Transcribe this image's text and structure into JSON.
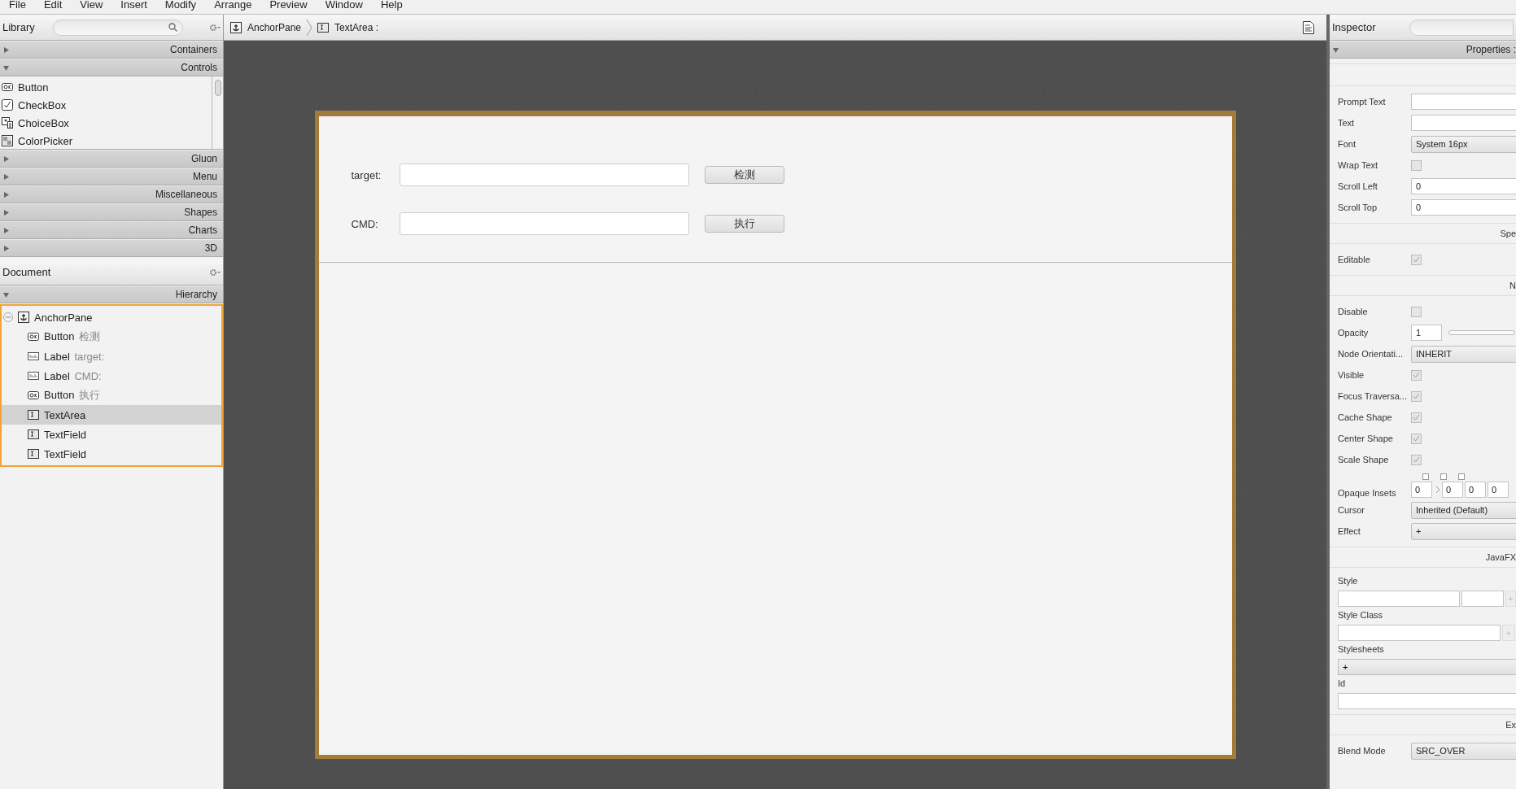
{
  "menu_bar": [
    "File",
    "Edit",
    "View",
    "Insert",
    "Modify",
    "Arrange",
    "Preview",
    "Window",
    "Help"
  ],
  "library": {
    "title": "Library",
    "sections": [
      {
        "label": "Containers",
        "expanded": false
      },
      {
        "label": "Controls",
        "expanded": true,
        "items": [
          {
            "label": "Button",
            "kind": "button"
          },
          {
            "label": "CheckBox",
            "kind": "checkbox"
          },
          {
            "label": "ChoiceBox",
            "kind": "choicebox"
          },
          {
            "label": "ColorPicker",
            "kind": "colorpicker"
          }
        ]
      },
      {
        "label": "Gluon",
        "expanded": false
      },
      {
        "label": "Menu",
        "expanded": false
      },
      {
        "label": "Miscellaneous",
        "expanded": false
      },
      {
        "label": "Shapes",
        "expanded": false
      },
      {
        "label": "Charts",
        "expanded": false
      },
      {
        "label": "3D",
        "expanded": false
      }
    ]
  },
  "document": {
    "title": "Document",
    "section": "Hierarchy",
    "tree": [
      {
        "label": "AnchorPane",
        "kind": "anchorpane",
        "expanded": true,
        "selected": false,
        "children": [
          {
            "label": "Button",
            "detail": "检测",
            "kind": "button",
            "selected": false
          },
          {
            "label": "Label",
            "detail": "target:",
            "kind": "label",
            "selected": false
          },
          {
            "label": "Label",
            "detail": "CMD:",
            "kind": "label",
            "selected": false
          },
          {
            "label": "Button",
            "detail": "执行",
            "kind": "button",
            "selected": false
          },
          {
            "label": "TextArea",
            "kind": "textarea",
            "selected": true
          },
          {
            "label": "TextField",
            "kind": "textfield",
            "selected": false
          },
          {
            "label": "TextField",
            "kind": "textfield",
            "selected": false
          }
        ]
      }
    ]
  },
  "breadcrumb": [
    {
      "label": "AnchorPane",
      "kind": "anchorpane"
    },
    {
      "label": "TextArea :",
      "kind": "textarea"
    }
  ],
  "canvas": {
    "rows": [
      {
        "label": "target:",
        "button": "检测"
      },
      {
        "label": "CMD:",
        "button": "执行"
      }
    ]
  },
  "inspector": {
    "title": "Inspector",
    "section": "Properties :",
    "rows": [
      {
        "kind": "section"
      },
      {
        "kind": "field",
        "label": "Prompt Text"
      },
      {
        "kind": "field",
        "label": "Text"
      },
      {
        "kind": "dropdown",
        "label": "Font",
        "value": "System 16px"
      },
      {
        "kind": "checkbox",
        "label": "Wrap Text",
        "checked": false
      },
      {
        "kind": "field",
        "label": "Scroll Left",
        "value": "0"
      },
      {
        "kind": "field",
        "label": "Scroll Top",
        "value": "0"
      },
      {
        "kind": "section",
        "label": "Spe"
      },
      {
        "kind": "checkbox",
        "label": "Editable",
        "checked": true
      },
      {
        "kind": "section",
        "label": "N"
      },
      {
        "kind": "checkbox",
        "label": "Disable",
        "checked": false
      },
      {
        "kind": "slider",
        "label": "Opacity",
        "value": "1"
      },
      {
        "kind": "dropdown",
        "label": "Node Orientati...",
        "value": "INHERIT"
      },
      {
        "kind": "checkbox",
        "label": "Visible",
        "checked": true
      },
      {
        "kind": "checkbox",
        "label": "Focus Traversa...",
        "checked": true
      },
      {
        "kind": "checkbox",
        "label": "Cache Shape",
        "checked": true
      },
      {
        "kind": "checkbox",
        "label": "Center Shape",
        "checked": true
      },
      {
        "kind": "checkbox",
        "label": "Scale Shape",
        "checked": true
      },
      {
        "kind": "insets",
        "label": "Opaque Insets",
        "values": [
          "0",
          "0",
          "0",
          "0"
        ],
        "links": [
          {
            "checked": false
          },
          {
            "checked": false
          },
          {
            "checked": false
          }
        ]
      },
      {
        "kind": "dropdown",
        "label": "Cursor",
        "value": "Inherited (Default)"
      },
      {
        "kind": "button",
        "label": "Effect",
        "value": "+"
      },
      {
        "kind": "section",
        "label": "JavaFX"
      },
      {
        "kind": "style",
        "label": "Style",
        "button": "+"
      },
      {
        "kind": "styleclass",
        "label": "Style Class",
        "button": "+"
      },
      {
        "kind": "stackbutton",
        "label": "Stylesheets",
        "value": "+"
      },
      {
        "kind": "stackfield",
        "label": "Id"
      },
      {
        "kind": "section",
        "label": "Ex"
      },
      {
        "kind": "dropdown",
        "label": "Blend Mode",
        "value": "SRC_OVER"
      }
    ]
  }
}
